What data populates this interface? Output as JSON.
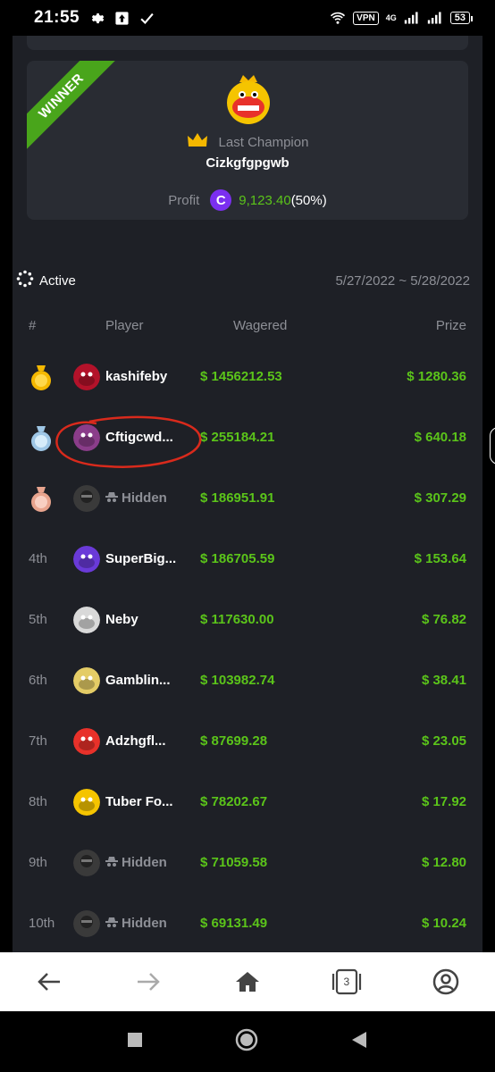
{
  "status_bar": {
    "time": "21:55",
    "vpn": "VPN",
    "network": "4G",
    "battery": "53"
  },
  "champion": {
    "ribbon": "WINNER",
    "label": "Last Champion",
    "name": "Cizkgfgpgwb",
    "profit_label": "Profit",
    "coin_symbol": "C",
    "profit_value": "9,123.40",
    "profit_percent": "(50%)"
  },
  "contest": {
    "status": "Active",
    "date_range": "5/27/2022 ~ 5/28/2022"
  },
  "table": {
    "headers": {
      "rank": "#",
      "player": "Player",
      "wagered": "Wagered",
      "prize": "Prize"
    },
    "rows": [
      {
        "rank": "",
        "medal": "gold",
        "player": "kashifeby",
        "hidden": false,
        "wagered": "$ 1456212.53",
        "prize": "$ 1280.36"
      },
      {
        "rank": "",
        "medal": "silver",
        "player": "Cftigcwd...",
        "hidden": false,
        "wagered": "$ 255184.21",
        "prize": "$ 640.18"
      },
      {
        "rank": "",
        "medal": "bronze",
        "player": "Hidden",
        "hidden": true,
        "wagered": "$ 186951.91",
        "prize": "$ 307.29"
      },
      {
        "rank": "4th",
        "medal": "",
        "player": "SuperBig...",
        "hidden": false,
        "wagered": "$ 186705.59",
        "prize": "$ 153.64"
      },
      {
        "rank": "5th",
        "medal": "",
        "player": "Neby",
        "hidden": false,
        "wagered": "$ 117630.00",
        "prize": "$ 76.82"
      },
      {
        "rank": "6th",
        "medal": "",
        "player": "Gamblin...",
        "hidden": false,
        "wagered": "$ 103982.74",
        "prize": "$ 38.41"
      },
      {
        "rank": "7th",
        "medal": "",
        "player": "Adzhgfl...",
        "hidden": false,
        "wagered": "$ 87699.28",
        "prize": "$ 23.05"
      },
      {
        "rank": "8th",
        "medal": "",
        "player": "Tuber Fo...",
        "hidden": false,
        "wagered": "$ 78202.67",
        "prize": "$ 17.92"
      },
      {
        "rank": "9th",
        "medal": "",
        "player": "Hidden",
        "hidden": true,
        "wagered": "$ 71059.58",
        "prize": "$ 12.80"
      },
      {
        "rank": "10th",
        "medal": "",
        "player": "Hidden",
        "hidden": true,
        "wagered": "$ 69131.49",
        "prize": "$ 10.24"
      }
    ]
  },
  "browser_nav": {
    "tab_count": "3"
  },
  "colors": {
    "accent_green": "#5bc41a",
    "ribbon_green": "#49a51b",
    "coin_purple": "#7b2ff0",
    "crown_gold": "#f5b800",
    "annotation_red": "#d92a1c"
  }
}
